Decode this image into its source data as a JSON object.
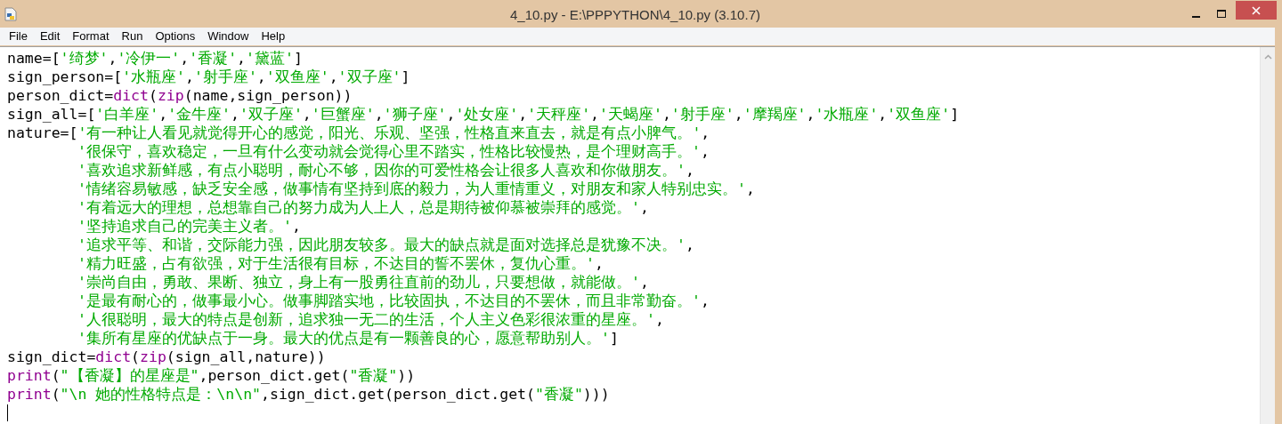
{
  "window": {
    "title": "4_10.py - E:\\PPPYTHON\\4_10.py (3.10.7)"
  },
  "menu": [
    "File",
    "Edit",
    "Format",
    "Run",
    "Options",
    "Window",
    "Help"
  ],
  "editor": {
    "lines": [
      {
        "continued": false,
        "tokens": [
          {
            "kind": "code",
            "text": "name=["
          },
          {
            "kind": "string",
            "text": "'绮梦'"
          },
          {
            "kind": "code",
            "text": ","
          },
          {
            "kind": "string",
            "text": "'冷伊一'"
          },
          {
            "kind": "code",
            "text": ","
          },
          {
            "kind": "string",
            "text": "'香凝'"
          },
          {
            "kind": "code",
            "text": ","
          },
          {
            "kind": "string",
            "text": "'黛蓝'"
          },
          {
            "kind": "code",
            "text": "]"
          }
        ]
      },
      {
        "continued": false,
        "tokens": [
          {
            "kind": "code",
            "text": "sign_person=["
          },
          {
            "kind": "string",
            "text": "'水瓶座'"
          },
          {
            "kind": "code",
            "text": ","
          },
          {
            "kind": "string",
            "text": "'射手座'"
          },
          {
            "kind": "code",
            "text": ","
          },
          {
            "kind": "string",
            "text": "'双鱼座'"
          },
          {
            "kind": "code",
            "text": ","
          },
          {
            "kind": "string",
            "text": "'双子座'"
          },
          {
            "kind": "code",
            "text": "]"
          }
        ]
      },
      {
        "continued": false,
        "tokens": [
          {
            "kind": "code",
            "text": "person_dict="
          },
          {
            "kind": "builtin",
            "text": "dict"
          },
          {
            "kind": "code",
            "text": "("
          },
          {
            "kind": "builtin",
            "text": "zip"
          },
          {
            "kind": "code",
            "text": "(name,sign_person))"
          }
        ]
      },
      {
        "continued": false,
        "tokens": [
          {
            "kind": "code",
            "text": "sign_all=["
          },
          {
            "kind": "string",
            "text": "'白羊座'"
          },
          {
            "kind": "code",
            "text": ","
          },
          {
            "kind": "string",
            "text": "'金牛座'"
          },
          {
            "kind": "code",
            "text": ","
          },
          {
            "kind": "string",
            "text": "'双子座'"
          },
          {
            "kind": "code",
            "text": ","
          },
          {
            "kind": "string",
            "text": "'巨蟹座'"
          },
          {
            "kind": "code",
            "text": ","
          },
          {
            "kind": "string",
            "text": "'狮子座'"
          },
          {
            "kind": "code",
            "text": ","
          },
          {
            "kind": "string",
            "text": "'处女座'"
          },
          {
            "kind": "code",
            "text": ","
          },
          {
            "kind": "string",
            "text": "'天秤座'"
          },
          {
            "kind": "code",
            "text": ","
          },
          {
            "kind": "string",
            "text": "'天蝎座'"
          },
          {
            "kind": "code",
            "text": ","
          },
          {
            "kind": "string",
            "text": "'射手座'"
          },
          {
            "kind": "code",
            "text": ","
          },
          {
            "kind": "string",
            "text": "'摩羯座'"
          },
          {
            "kind": "code",
            "text": ","
          },
          {
            "kind": "string",
            "text": "'水瓶座'"
          },
          {
            "kind": "code",
            "text": ","
          },
          {
            "kind": "string",
            "text": "'双鱼座'"
          },
          {
            "kind": "code",
            "text": "]"
          }
        ]
      },
      {
        "continued": false,
        "tokens": [
          {
            "kind": "code",
            "text": "nature=["
          },
          {
            "kind": "string",
            "text": "'有一种让人看见就觉得开心的感觉，阳光、乐观、坚强，性格直来直去，就是有点小脾气。'"
          },
          {
            "kind": "code",
            "text": ","
          }
        ]
      },
      {
        "continued": true,
        "tokens": [
          {
            "kind": "string",
            "text": "'很保守，喜欢稳定，一旦有什么变动就会觉得心里不踏实，性格比较慢热，是个理财高手。'"
          },
          {
            "kind": "code",
            "text": ","
          }
        ]
      },
      {
        "continued": true,
        "tokens": [
          {
            "kind": "string",
            "text": "'喜欢追求新鲜感，有点小聪明，耐心不够，因你的可爱性格会让很多人喜欢和你做朋友。'"
          },
          {
            "kind": "code",
            "text": ","
          }
        ]
      },
      {
        "continued": true,
        "tokens": [
          {
            "kind": "string",
            "text": "'情绪容易敏感，缺乏安全感，做事情有坚持到底的毅力，为人重情重义，对朋友和家人特别忠实。'"
          },
          {
            "kind": "code",
            "text": ","
          }
        ]
      },
      {
        "continued": true,
        "tokens": [
          {
            "kind": "string",
            "text": "'有着远大的理想，总想靠自己的努力成为人上人，总是期待被仰慕被崇拜的感觉。'"
          },
          {
            "kind": "code",
            "text": ","
          }
        ]
      },
      {
        "continued": true,
        "tokens": [
          {
            "kind": "string",
            "text": "'坚持追求自己的完美主义者。'"
          },
          {
            "kind": "code",
            "text": ","
          }
        ]
      },
      {
        "continued": true,
        "tokens": [
          {
            "kind": "string",
            "text": "'追求平等、和谐，交际能力强，因此朋友较多。最大的缺点就是面对选择总是犹豫不决。'"
          },
          {
            "kind": "code",
            "text": ","
          }
        ]
      },
      {
        "continued": true,
        "tokens": [
          {
            "kind": "string",
            "text": "'精力旺盛，占有欲强，对于生活很有目标，不达目的誓不罢休，复仇心重。'"
          },
          {
            "kind": "code",
            "text": ","
          }
        ]
      },
      {
        "continued": true,
        "tokens": [
          {
            "kind": "string",
            "text": "'崇尚自由，勇敢、果断、独立，身上有一股勇往直前的劲儿，只要想做，就能做。'"
          },
          {
            "kind": "code",
            "text": ","
          }
        ]
      },
      {
        "continued": true,
        "tokens": [
          {
            "kind": "string",
            "text": "'是最有耐心的，做事最小心。做事脚踏实地，比较固执，不达目的不罢休，而且非常勤奋。'"
          },
          {
            "kind": "code",
            "text": ","
          }
        ]
      },
      {
        "continued": true,
        "tokens": [
          {
            "kind": "string",
            "text": "'人很聪明，最大的特点是创新，追求独一无二的生活，个人主义色彩很浓重的星座。'"
          },
          {
            "kind": "code",
            "text": ","
          }
        ]
      },
      {
        "continued": true,
        "tokens": [
          {
            "kind": "string",
            "text": "'集所有星座的优缺点于一身。最大的优点是有一颗善良的心，愿意帮助别人。'"
          },
          {
            "kind": "code",
            "text": "]"
          }
        ]
      },
      {
        "continued": false,
        "tokens": [
          {
            "kind": "code",
            "text": "sign_dict="
          },
          {
            "kind": "builtin",
            "text": "dict"
          },
          {
            "kind": "code",
            "text": "("
          },
          {
            "kind": "builtin",
            "text": "zip"
          },
          {
            "kind": "code",
            "text": "(sign_all,nature))"
          }
        ]
      },
      {
        "continued": false,
        "tokens": [
          {
            "kind": "builtin",
            "text": "print"
          },
          {
            "kind": "code",
            "text": "("
          },
          {
            "kind": "string",
            "text": "\"【香凝】的星座是\""
          },
          {
            "kind": "code",
            "text": ",person_dict.get("
          },
          {
            "kind": "string",
            "text": "\"香凝\""
          },
          {
            "kind": "code",
            "text": "))"
          }
        ]
      },
      {
        "continued": false,
        "tokens": [
          {
            "kind": "builtin",
            "text": "print"
          },
          {
            "kind": "code",
            "text": "("
          },
          {
            "kind": "string",
            "text": "\"\\n 她的性格特点是：\\n\\n\""
          },
          {
            "kind": "code",
            "text": ",sign_dict.get(person_dict.get("
          },
          {
            "kind": "string",
            "text": "\"香凝\""
          },
          {
            "kind": "code",
            "text": ")))"
          }
        ]
      }
    ]
  }
}
